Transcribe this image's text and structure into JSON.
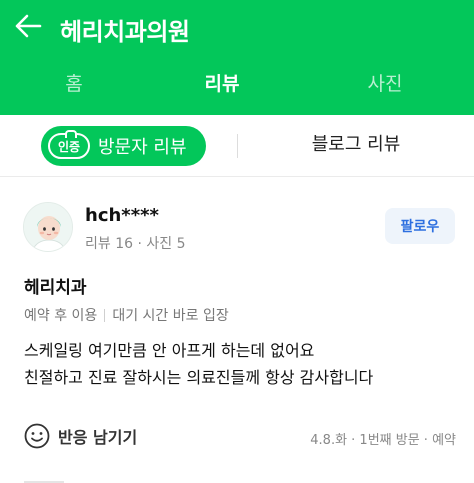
{
  "header": {
    "title": "헤리치과의원",
    "back_icon": "arrow-left-icon",
    "background_color": "#03c75a"
  },
  "tabs": [
    {
      "label": "홈",
      "active": false
    },
    {
      "label": "리뷰",
      "active": true
    },
    {
      "label": "사진",
      "active": false
    }
  ],
  "review_type": {
    "visitor_badge": "인증",
    "visitor_label": "방문자 리뷰",
    "blog_label": "블로그 리뷰"
  },
  "review": {
    "username": "hch****",
    "stats": "리뷰 16 · 사진 5",
    "follow_label": "팔로우",
    "place_name": "헤리치과",
    "tags": [
      "예약 후 이용",
      "대기 시간 바로 입장"
    ],
    "text_lines": [
      "스케일링 여기만큼 안 아프게 하는데 없어요",
      "친절하고 진료 잘하시는 의료진들께 항상 감사합니다"
    ],
    "react_icon": "smile-icon",
    "react_label": "반응 남기기",
    "visit_info": "4.8.화 · 1번째 방문 · 예약"
  },
  "colors": {
    "brand_green": "#03c75a",
    "follow_text": "#2d6fe0",
    "follow_bg": "#eef4fb"
  }
}
